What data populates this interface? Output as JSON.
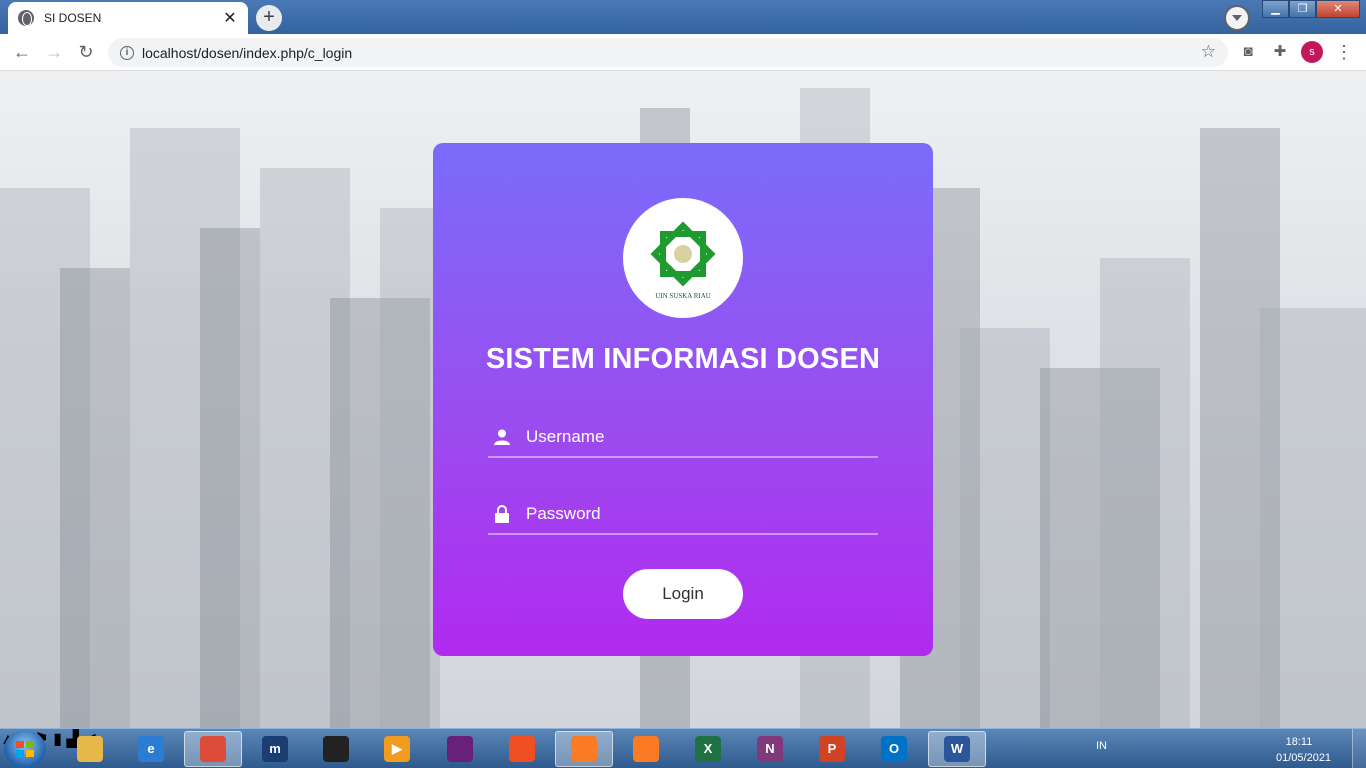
{
  "browser": {
    "tab_title": "SI DOSEN",
    "tab_close": "✕",
    "new_tab": "+",
    "url": "localhost/dosen/index.php/c_login",
    "profile_initial": "s"
  },
  "login": {
    "logo_caption": "UIN SUSKA RIAU",
    "heading": "SISTEM INFORMASI DOSEN",
    "username_placeholder": "Username",
    "password_placeholder": "Password",
    "login_label": "Login",
    "colors": {
      "card_top": "#7a6cfb",
      "card_bottom": "#b02af0"
    }
  },
  "taskbar": {
    "apps": [
      {
        "name": "file-explorer",
        "letter": "",
        "color": "#e6b84a"
      },
      {
        "name": "internet-explorer",
        "letter": "e",
        "color": "#2b7cd3"
      },
      {
        "name": "chrome",
        "letter": "",
        "color": "#dd4b39"
      },
      {
        "name": "maxthon",
        "letter": "m",
        "color": "#1a3e72"
      },
      {
        "name": "inkscape",
        "letter": "",
        "color": "#222222"
      },
      {
        "name": "media-player",
        "letter": "▶",
        "color": "#f29c1f"
      },
      {
        "name": "visual-studio",
        "letter": "",
        "color": "#68217a"
      },
      {
        "name": "screen-recorder",
        "letter": "",
        "color": "#f04e23"
      },
      {
        "name": "xampp-1",
        "letter": "",
        "color": "#fb7a24"
      },
      {
        "name": "xampp-2",
        "letter": "",
        "color": "#fb7a24"
      },
      {
        "name": "excel",
        "letter": "X",
        "color": "#1f7244"
      },
      {
        "name": "onenote",
        "letter": "N",
        "color": "#80397b"
      },
      {
        "name": "powerpoint",
        "letter": "P",
        "color": "#d04423"
      },
      {
        "name": "outlook",
        "letter": "O",
        "color": "#0072c6"
      },
      {
        "name": "word",
        "letter": "W",
        "color": "#2b579a"
      }
    ],
    "language": "IN",
    "time": "18:11",
    "date": "01/05/2021"
  }
}
